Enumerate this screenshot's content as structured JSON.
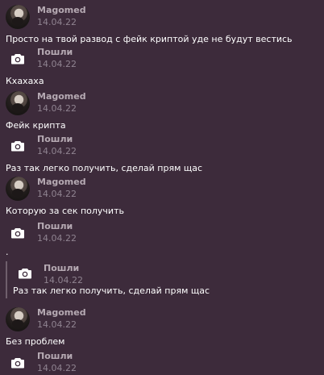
{
  "messages": [
    {
      "author": "Magomed",
      "time": "14.04.22",
      "text": "Просто на твой развод с фейк криптой уде не будут вестись"
    },
    {
      "author": "Пошли",
      "time": "14.04.22",
      "text": "Кхахаха"
    },
    {
      "author": "Magomed",
      "time": "14.04.22",
      "text": "Фейк крипта"
    },
    {
      "author": "Пошли",
      "time": "14.04.22",
      "text": "Раз так легко получить, сделай прям щас"
    },
    {
      "author": "Magomed",
      "time": "14.04.22",
      "text": "Которую за сек получить"
    },
    {
      "author": "Пошли",
      "time": "14.04.22",
      "text": "."
    },
    {
      "author": "Magomed",
      "time": "14.04.22",
      "text": "Без проблем"
    },
    {
      "author": "Пошли",
      "time": "14.04.22"
    }
  ],
  "quote": {
    "author": "Пошли",
    "time": "14.04.22",
    "text": "Раз так легко получить, сделай прям щас"
  },
  "icons": {
    "avatar": "avatar-magomed",
    "camera": "camera-icon"
  },
  "colors": {
    "background": "#3d2b3b",
    "text": "#ffffff",
    "author": "#b6aab3",
    "time": "#8f8390"
  }
}
